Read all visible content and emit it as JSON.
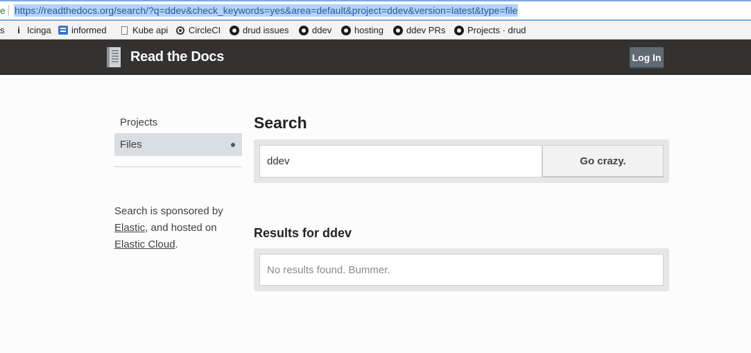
{
  "urlbar": {
    "prefix": "e",
    "url": "https://readthedocs.org/search/?q=ddev&check_keywords=yes&area=default&project=ddev&version=latest&type=file"
  },
  "bookmarks": [
    {
      "label": "s",
      "icon": "none"
    },
    {
      "label": "Icinga",
      "icon": "icinga-icon"
    },
    {
      "label": "informed",
      "icon": "informed-icon"
    },
    {
      "label": "Kube api",
      "icon": "page-icon"
    },
    {
      "label": "CircleCI",
      "icon": "circleci-icon"
    },
    {
      "label": "drud issues",
      "icon": "github-icon"
    },
    {
      "label": "ddev",
      "icon": "github-icon"
    },
    {
      "label": "hosting",
      "icon": "github-icon"
    },
    {
      "label": "ddev PRs",
      "icon": "github-icon"
    },
    {
      "label": "Projects · drud",
      "icon": "github-icon"
    }
  ],
  "header": {
    "brand": "Read the Docs",
    "login_label": "Log In"
  },
  "sidebar": {
    "items": [
      {
        "label": "Projects",
        "active": false
      },
      {
        "label": "Files",
        "active": true
      }
    ],
    "sponsor": {
      "text1": "Search is sponsored by",
      "link1": "Elastic",
      "text2": ", and hosted on",
      "link2": "Elastic Cloud",
      "text3": "."
    }
  },
  "main": {
    "search_title": "Search",
    "search_value": "ddev",
    "search_button": "Go crazy.",
    "results_title": "Results for ddev",
    "results_message": "No results found. Bummer."
  }
}
